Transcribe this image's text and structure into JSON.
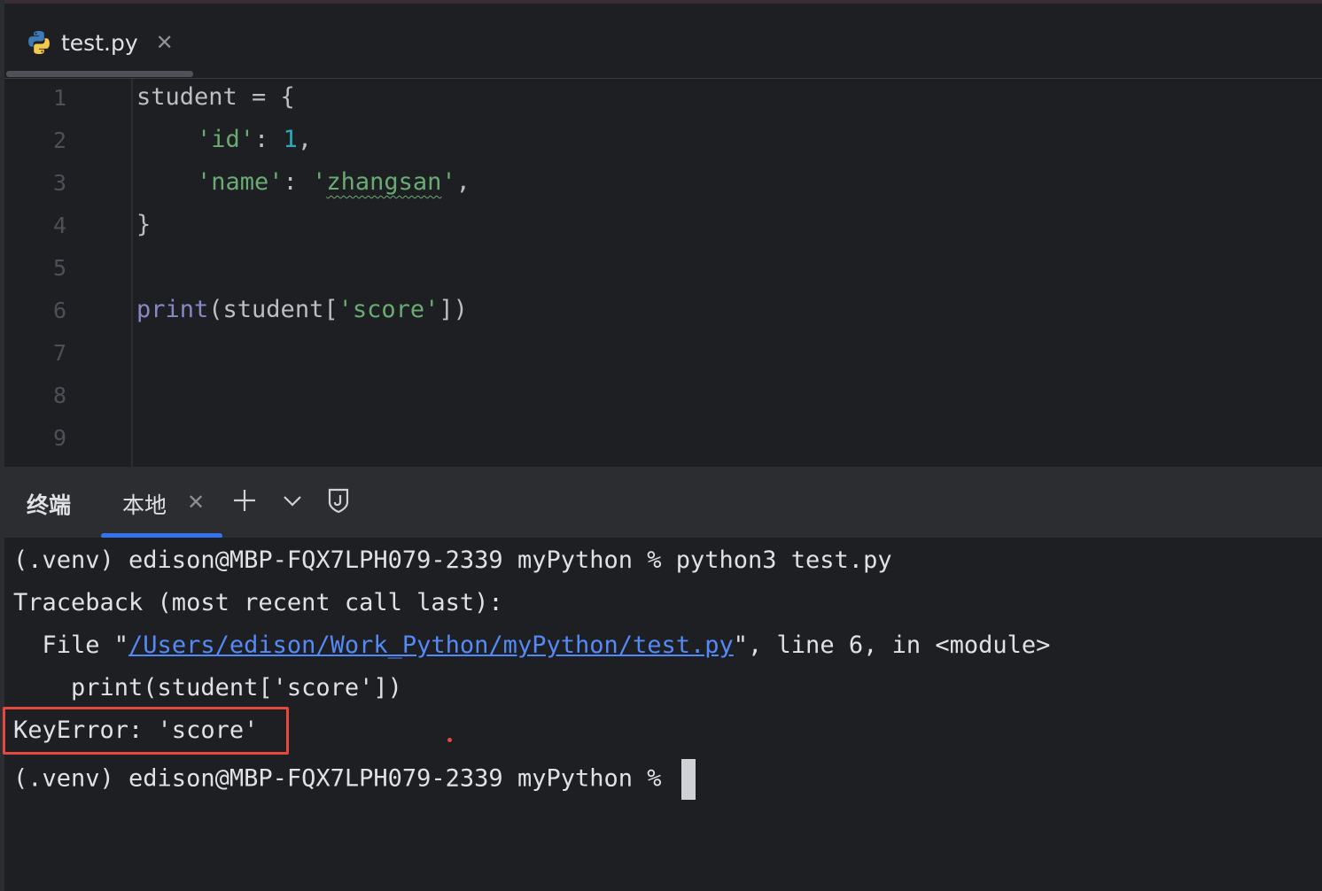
{
  "tab": {
    "filename": "test.py",
    "file_icon": "python-icon",
    "close_icon": "close-icon"
  },
  "editor": {
    "line_numbers": [
      "1",
      "2",
      "3",
      "4",
      "5",
      "6",
      "7",
      "8",
      "9"
    ],
    "code": {
      "l1": "student = {",
      "l2_key": "'id'",
      "l2_colon": ": ",
      "l2_val": "1",
      "l2_comma": ",",
      "l3_key": "'name'",
      "l3_colon": ": ",
      "l3_q1": "'",
      "l3_val": "zhangsan",
      "l3_q2": "'",
      "l3_comma": ",",
      "l4": "}",
      "l6_fn": "print",
      "l6_a": "(student[",
      "l6_str": "'score'",
      "l6_b": "])"
    }
  },
  "terminal": {
    "title": "终端",
    "tab_label": "本地",
    "icons": {
      "close": "close-icon",
      "add": "plus-icon",
      "dropdown": "chevron-down-icon",
      "shield": "shield-icon"
    },
    "lines": {
      "cmd": "(.venv) edison@MBP-FQX7LPH079-2339 myPython % python3 test.py",
      "traceback": "Traceback (most recent call last):",
      "file_prefix": "  File \"",
      "file_path": "/Users/edison/Work_Python/myPython/test.py",
      "file_suffix": "\", line 6, in <module>",
      "code": "    print(student['score'])",
      "error": "KeyError: 'score'",
      "prompt": "(.venv) edison@MBP-FQX7LPH079-2339 myPython % "
    }
  }
}
